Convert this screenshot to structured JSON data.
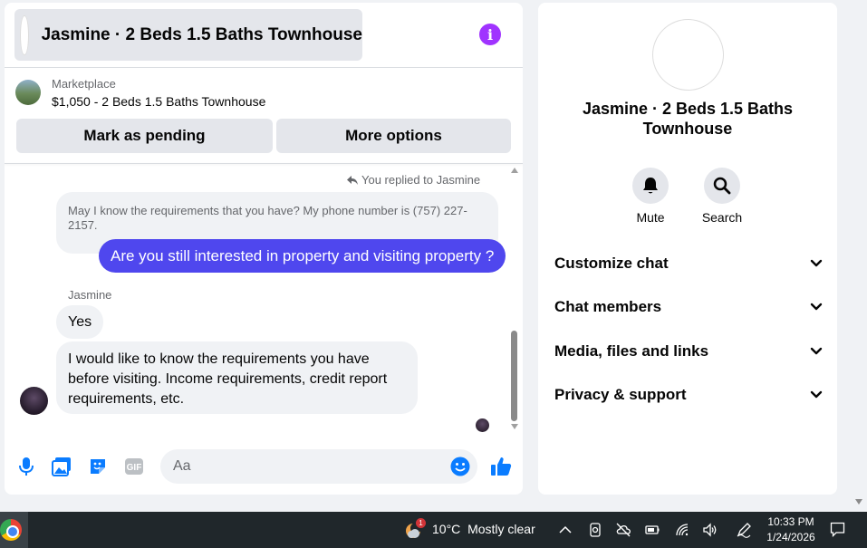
{
  "chat": {
    "title": "Jasmine · 2 Beds 1.5 Baths Townhouse",
    "info_icon": "info-icon",
    "marketplace": {
      "label": "Marketplace",
      "listing": "$1,050 - 2 Beds 1.5 Baths Townhouse"
    },
    "buttons": {
      "pending": "Mark as pending",
      "more": "More options"
    },
    "replied_note": "You replied to Jasmine",
    "quoted_message": "May I know the requirements that you have? My phone number is (757) 227-2157.",
    "sent_message": "Are you still interested in property and visiting property ?",
    "sender_name": "Jasmine",
    "received_messages": [
      "Yes",
      "I would like to know the requirements you have before visiting. Income requirements, credit report requirements, etc."
    ],
    "composer": {
      "placeholder": "Aa",
      "icons": [
        "microphone-icon",
        "photo-icon",
        "sticker-icon",
        "gif-icon",
        "emoji-icon",
        "thumbs-up-icon"
      ],
      "gif_label": "GIF"
    }
  },
  "info_panel": {
    "title": "Jasmine · 2 Beds 1.5 Baths Townhouse",
    "actions": [
      {
        "label": "Mute",
        "icon": "bell-icon"
      },
      {
        "label": "Search",
        "icon": "search-icon"
      }
    ],
    "sections": [
      "Customize chat",
      "Chat members",
      "Media, files and links",
      "Privacy & support"
    ]
  },
  "taskbar": {
    "weather_temp": "10°C",
    "weather_desc": "Mostly clear",
    "weather_badge": "1",
    "time": "10:33 PM",
    "date": "1/24/2026"
  },
  "colors": {
    "accent": "#a033ff",
    "sent_bubble": "#4f47ee",
    "icon_blue": "#0a7cff"
  }
}
